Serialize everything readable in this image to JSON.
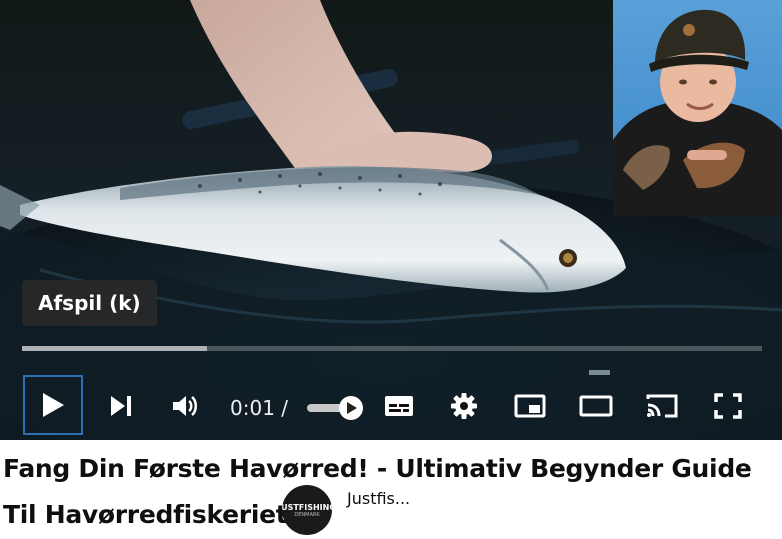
{
  "player": {
    "tooltip": "Afspil (k)",
    "time_current": "0:01",
    "time_separator": " / ",
    "progress": {
      "played_fraction": 0.0,
      "loaded_fraction": 0.25
    },
    "volume_fraction": 0.75
  },
  "controls": {
    "play": "play-icon",
    "next": "next-icon",
    "volume": "volume-icon",
    "subtitles": "subtitles-icon",
    "settings": "gear-icon",
    "miniplayer": "miniplayer-icon",
    "theater": "theater-icon",
    "cast": "cast-icon",
    "fullscreen": "fullscreen-icon"
  },
  "video": {
    "title": "Fang Din Første Havørred! - Ultimativ Begynder Guide Til Havørredfiskeriet!",
    "channel": {
      "name": "Justfis...",
      "logo_text": "JUSTFISHING",
      "logo_subtext": "DENMARK"
    }
  },
  "colors": {
    "progress_played": "#ff0000",
    "focus_outline": "#2c6fb5",
    "title_text": "#0f0f0f"
  }
}
